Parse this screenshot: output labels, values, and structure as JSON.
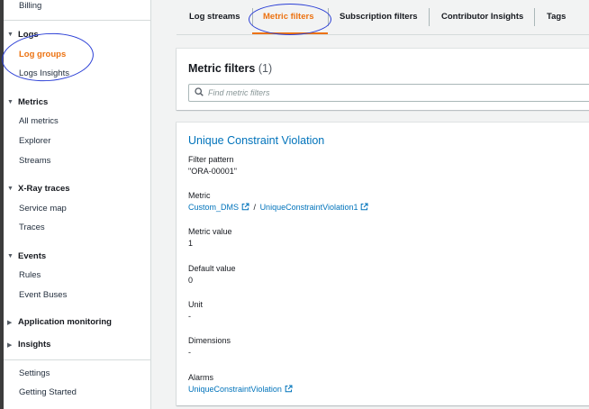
{
  "sidebar": {
    "top_item": "Billing",
    "logs": {
      "title": "Logs",
      "items": [
        {
          "label": "Log groups",
          "active": true
        },
        {
          "label": "Logs Insights",
          "active": false
        }
      ]
    },
    "metrics": {
      "title": "Metrics",
      "items": [
        {
          "label": "All metrics"
        },
        {
          "label": "Explorer"
        },
        {
          "label": "Streams"
        }
      ]
    },
    "xray": {
      "title": "X-Ray traces",
      "items": [
        {
          "label": "Service map"
        },
        {
          "label": "Traces"
        }
      ]
    },
    "events": {
      "title": "Events",
      "items": [
        {
          "label": "Rules"
        },
        {
          "label": "Event Buses"
        }
      ]
    },
    "app_monitoring": {
      "title": "Application monitoring"
    },
    "insights": {
      "title": "Insights"
    },
    "footer": [
      {
        "label": "Settings"
      },
      {
        "label": "Getting Started"
      }
    ]
  },
  "tabs": [
    {
      "label": "Log streams",
      "active": false
    },
    {
      "label": "Metric filters",
      "active": true
    },
    {
      "label": "Subscription filters",
      "active": false
    },
    {
      "label": "Contributor Insights",
      "active": false
    },
    {
      "label": "Tags",
      "active": false
    }
  ],
  "metric_filters_panel": {
    "title": "Metric filters",
    "count": "(1)",
    "search_placeholder": "Find metric filters"
  },
  "filter": {
    "name": "Unique Constraint Violation",
    "filter_pattern_label": "Filter pattern",
    "filter_pattern_value": "\"ORA-00001\"",
    "metric_label": "Metric",
    "metric_namespace": "Custom_DMS",
    "metric_separator": "/",
    "metric_name": "UniqueConstraintViolation1",
    "metric_value_label": "Metric value",
    "metric_value": "1",
    "default_value_label": "Default value",
    "default_value": "0",
    "unit_label": "Unit",
    "unit_value": "-",
    "dimensions_label": "Dimensions",
    "dimensions_value": "-",
    "alarms_label": "Alarms",
    "alarm_name": "UniqueConstraintViolation"
  },
  "colors": {
    "accent_orange": "#ec7211",
    "link_blue": "#0073bb",
    "annotation_blue": "#2b3fd6"
  },
  "icons": {
    "caret_expanded": "caret-down-icon",
    "caret_collapsed": "caret-right-icon",
    "search": "search-icon",
    "external_link": "external-link-icon"
  }
}
